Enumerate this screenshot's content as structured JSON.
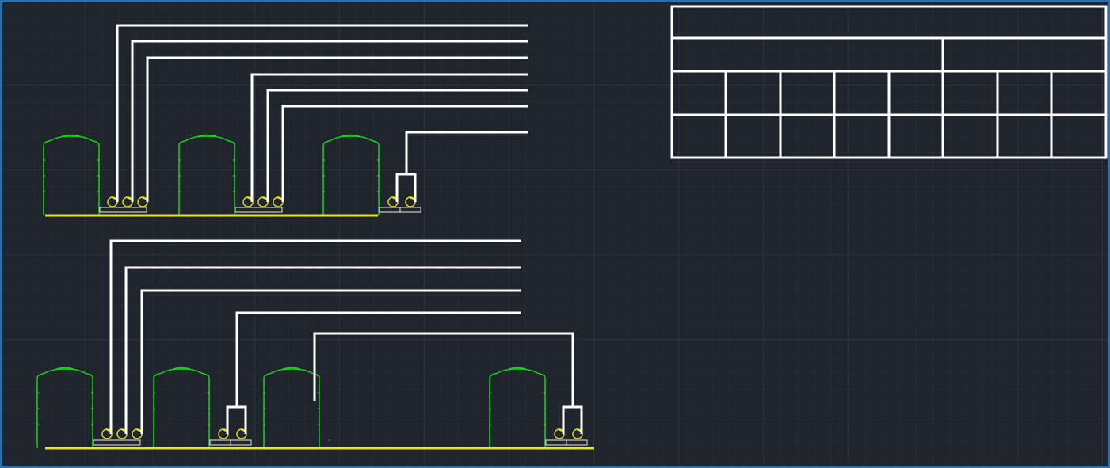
{
  "canvas": {
    "background": "#1f242d",
    "grid_minor": "#283039",
    "grid_major": "#353e49",
    "frame_color": "#2f6fa8"
  },
  "colors": {
    "tank": "#19d219",
    "pump": "#e6e01a",
    "pipe": "#ffffff",
    "base": "#e8e32a",
    "table": "#ffffff"
  },
  "drawing": {
    "upper_row_tanks": 3,
    "lower_row_tanks": 4,
    "pipe_runs_upper": 7,
    "pipe_runs_lower": 5
  },
  "schedule_table": {
    "header_text": "",
    "subheader_left": "",
    "subheader_right": "",
    "rows": [
      [
        "",
        "",
        "",
        "",
        "",
        "",
        "",
        ""
      ],
      [
        "",
        "",
        "",
        "",
        "",
        "",
        "",
        ""
      ]
    ]
  }
}
